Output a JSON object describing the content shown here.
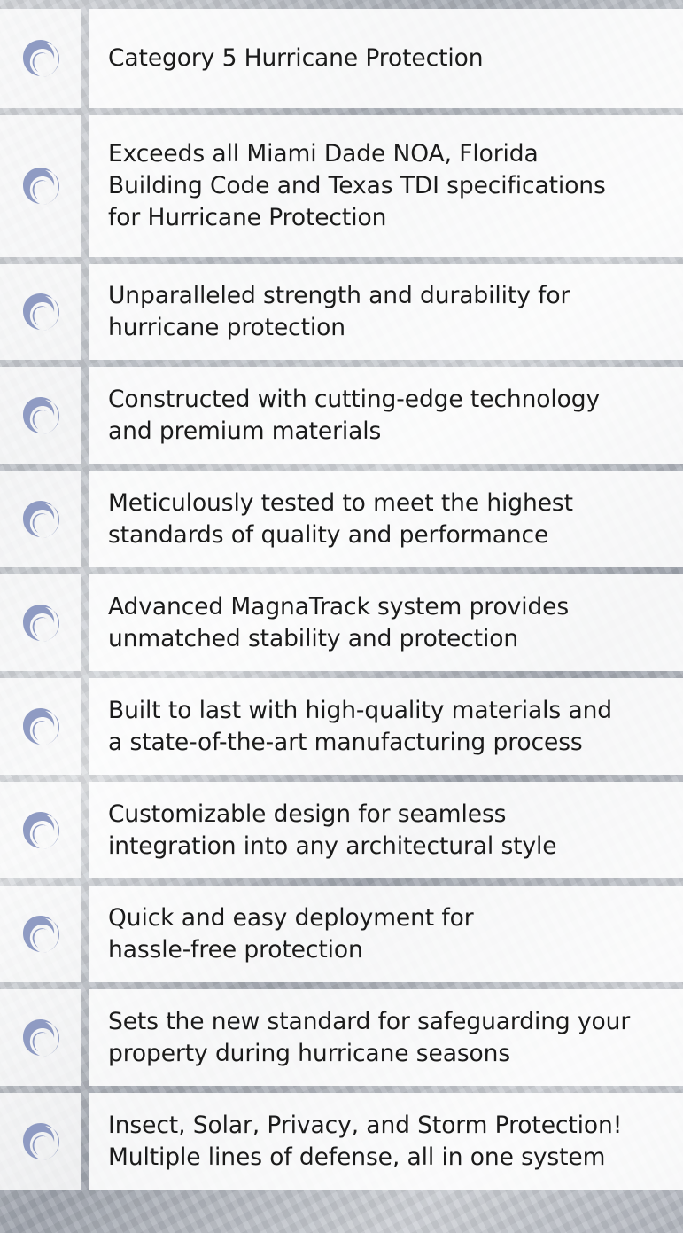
{
  "features": [
    {
      "icon": "hurricane-icon",
      "text": "Category 5 Hurricane Protection"
    },
    {
      "icon": "hurricane-icon",
      "text": "Exceeds all Miami Dade NOA, Florida\nBuilding Code and Texas TDI specifications\nfor Hurricane Protection"
    },
    {
      "icon": "hurricane-icon",
      "text": "Unparalleled strength and durability for\nhurricane protection"
    },
    {
      "icon": "hurricane-icon",
      "text": "Constructed with cutting-edge technology\nand premium materials"
    },
    {
      "icon": "hurricane-icon",
      "text": "Meticulously tested to meet the highest\nstandards of quality and performance"
    },
    {
      "icon": "hurricane-icon",
      "text": "Advanced MagnaTrack system provides\nunmatched stability and protection"
    },
    {
      "icon": "hurricane-icon",
      "text": "Built to last with high-quality materials and\na state-of-the-art manufacturing process"
    },
    {
      "icon": "hurricane-icon",
      "text": "Customizable design for seamless\nintegration into any architectural style"
    },
    {
      "icon": "hurricane-icon",
      "text": "Quick and easy deployment for\nhassle-free protection"
    },
    {
      "icon": "hurricane-icon",
      "text": "Sets the new standard for safeguarding your\nproperty during hurricane seasons"
    },
    {
      "icon": "hurricane-icon",
      "text": "Insect, Solar, Privacy, and Storm Protection!\nMultiple lines of defense, all in one system"
    }
  ],
  "colors": {
    "icon": "#8f9bc3",
    "text": "#1b1b1b"
  }
}
